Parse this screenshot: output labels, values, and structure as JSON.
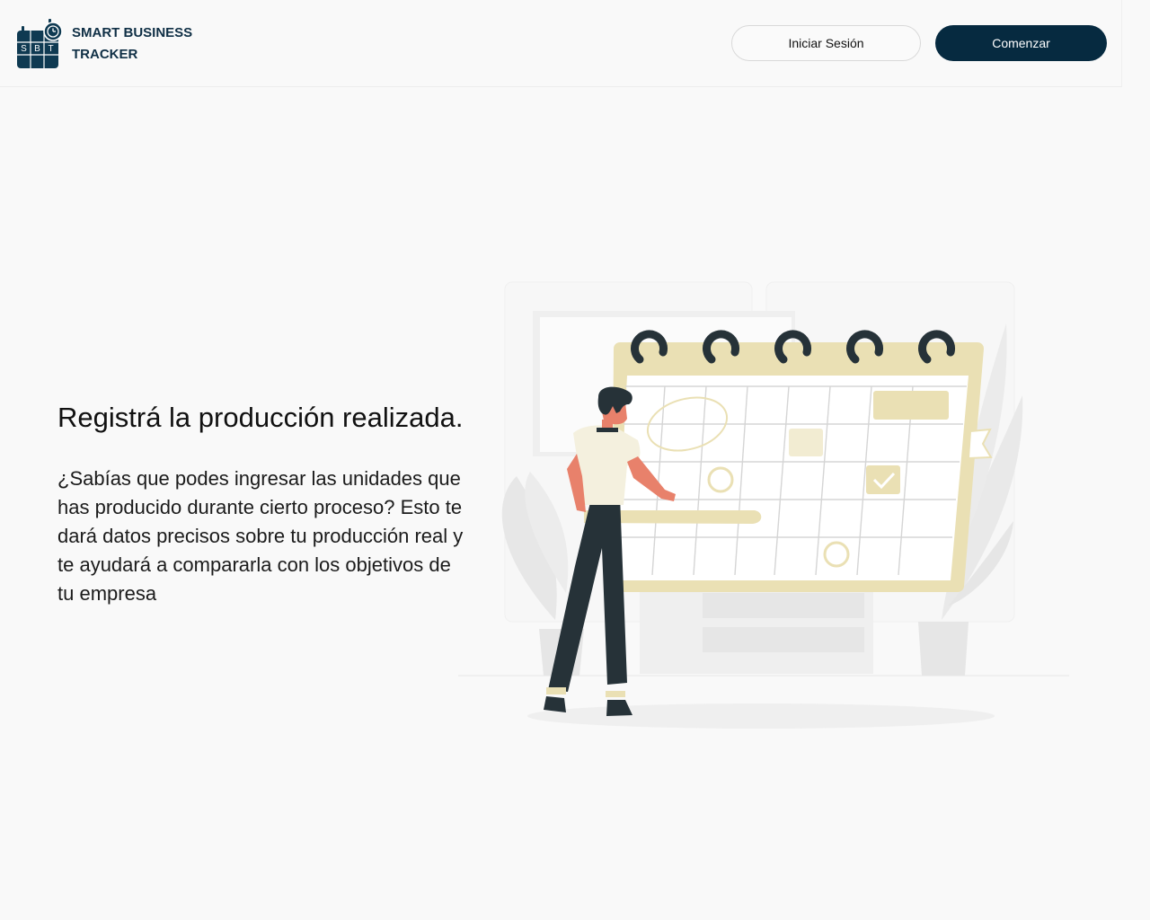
{
  "header": {
    "logo_letters": [
      "S",
      "B",
      "T"
    ],
    "brand_name": "SMART BUSINESS TRACKER",
    "login_label": "Iniciar Sesión",
    "start_label": "Comenzar"
  },
  "hero": {
    "title": "Registrá la producción realizada.",
    "description": "¿Sabías que podes ingresar las unidades que has producido durante cierto proceso? Esto te dará datos precisos sobre tu producción real y te ayudará a compararla con los objetivos de tu empresa"
  },
  "illustration": {
    "icon": "calendar-planning-illustration",
    "accent": "#eae0b4",
    "dark": "#263238"
  },
  "colors": {
    "brand": "#062a40",
    "background": "#f9f9f9"
  }
}
